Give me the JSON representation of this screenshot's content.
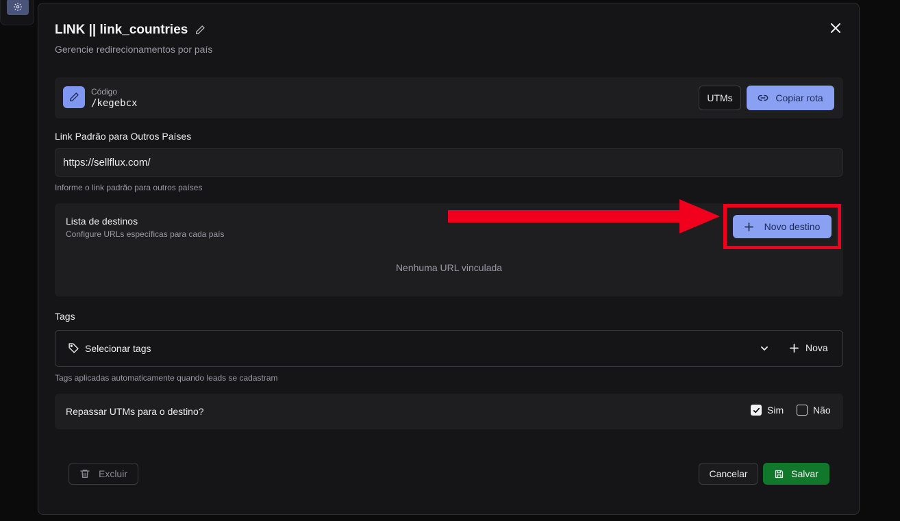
{
  "background": {
    "settings_icon": "gear-icon"
  },
  "modal": {
    "title": "LINK || link_countries",
    "subtitle": "Gerencie redirecionamentos por país",
    "edit_icon": "pencil-icon",
    "close_icon": "close-icon"
  },
  "code": {
    "label": "Código",
    "value": "/kegebcx",
    "utms_button": "UTMs",
    "copy_button": "Copiar rota"
  },
  "default_link": {
    "label": "Link Padrão para Outros Países",
    "value": "https://sellflux.com/",
    "hint": "Informe o link padrão para outros países"
  },
  "destinations": {
    "title": "Lista de destinos",
    "subtitle": "Configure URLs específicas para cada país",
    "new_button": "Novo destino",
    "empty": "Nenhuma URL vinculada"
  },
  "tags": {
    "label": "Tags",
    "placeholder": "Selecionar tags",
    "new_button": "Nova",
    "hint": "Tags aplicadas automaticamente quando leads se cadastram"
  },
  "utm_forward": {
    "label": "Repassar UTMs para o destino?",
    "yes": "Sim",
    "no": "Não",
    "yes_checked": true,
    "no_checked": false
  },
  "footer": {
    "delete_button": "Excluir",
    "cancel_button": "Cancelar",
    "save_button": "Salvar"
  },
  "colors": {
    "accent": "#8aa1f3",
    "save": "#11772b",
    "annotation": "#f0001c"
  }
}
